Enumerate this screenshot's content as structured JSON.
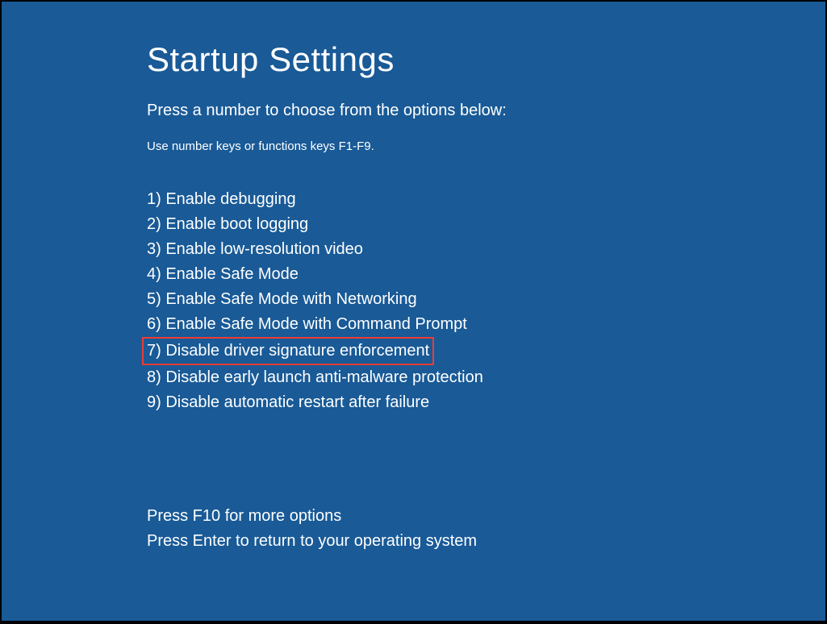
{
  "title": "Startup Settings",
  "instruction": "Press a number to choose from the options below:",
  "subinstruction": "Use number keys or functions keys F1-F9.",
  "options": [
    {
      "label": "1) Enable debugging",
      "highlighted": false
    },
    {
      "label": "2) Enable boot logging",
      "highlighted": false
    },
    {
      "label": "3) Enable low-resolution video",
      "highlighted": false
    },
    {
      "label": "4) Enable Safe Mode",
      "highlighted": false
    },
    {
      "label": "5) Enable Safe Mode with Networking",
      "highlighted": false
    },
    {
      "label": "6) Enable Safe Mode with Command Prompt",
      "highlighted": false
    },
    {
      "label": "7) Disable driver signature enforcement",
      "highlighted": true
    },
    {
      "label": "8) Disable early launch anti-malware protection",
      "highlighted": false
    },
    {
      "label": "9) Disable automatic restart after failure",
      "highlighted": false
    }
  ],
  "footer": {
    "line1": "Press F10 for more options",
    "line2": "Press Enter to return to your operating system"
  },
  "colors": {
    "background": "#195a97",
    "text": "#ffffff",
    "highlight_border": "#ee3b33"
  }
}
